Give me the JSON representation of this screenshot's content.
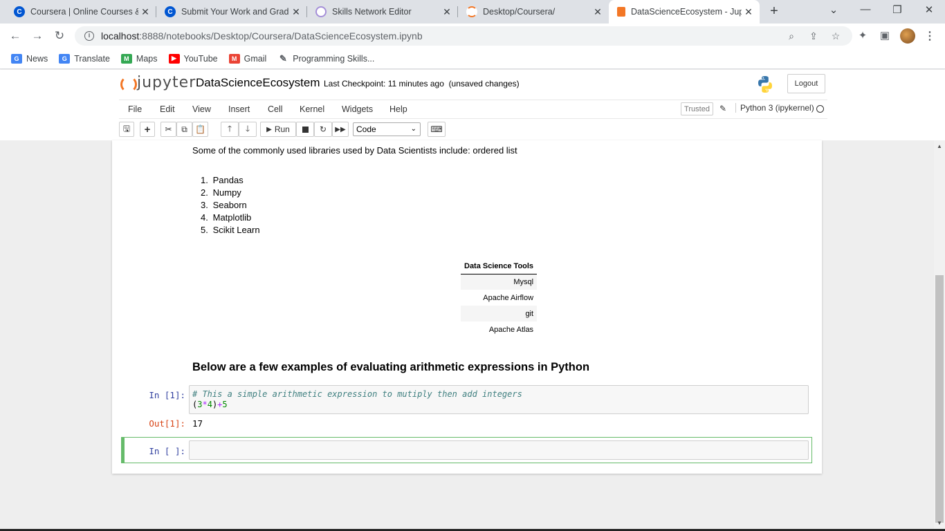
{
  "browser": {
    "tabs": [
      {
        "title": "Coursera | Online Courses &",
        "favicon": "C",
        "color": "#0056d2"
      },
      {
        "title": "Submit Your Work and Grade",
        "favicon": "C",
        "color": "#0056d2"
      },
      {
        "title": "Skills Network Editor",
        "favicon": "",
        "color": "#a58fd8"
      },
      {
        "title": "Desktop/Coursera/",
        "favicon": "",
        "color": "#f37726"
      },
      {
        "title": "DataScienceEcosystem - Jupy",
        "favicon": "",
        "color": "#f37726"
      }
    ],
    "url_host": "localhost",
    "url_rest": ":8888/notebooks/Desktop/Coursera/DataScienceEcosystem.ipynb",
    "bookmarks": [
      {
        "label": "News",
        "color": "#4285f4",
        "glyph": "G"
      },
      {
        "label": "Translate",
        "color": "#4285f4",
        "glyph": "G"
      },
      {
        "label": "Maps",
        "color": "#34a853",
        "glyph": "M"
      },
      {
        "label": "YouTube",
        "color": "#ff0000",
        "glyph": "▶"
      },
      {
        "label": "Gmail",
        "color": "#ea4335",
        "glyph": "M"
      },
      {
        "label": "Programming Skills...",
        "color": "#5f6368",
        "glyph": "✎"
      }
    ]
  },
  "jupyter": {
    "logo_text": "jupyter",
    "notebook_name": "DataScienceEcosystem",
    "checkpoint": "Last Checkpoint: 11 minutes ago",
    "unsaved": "(unsaved changes)",
    "logout_label": "Logout",
    "menu": [
      "File",
      "Edit",
      "View",
      "Insert",
      "Cell",
      "Kernel",
      "Widgets",
      "Help"
    ],
    "trusted_label": "Trusted",
    "kernel_name": "Python 3 (ipykernel)",
    "run_label": "Run",
    "cell_type": "Code"
  },
  "notebook": {
    "intro": "Some of the commonly used libraries used by Data Scientists include: ordered list",
    "libraries": [
      {
        "num": "1.",
        "name": "Pandas"
      },
      {
        "num": "2.",
        "name": "Numpy"
      },
      {
        "num": "3.",
        "name": "Seaborn"
      },
      {
        "num": "4.",
        "name": "Matplotlib"
      },
      {
        "num": "5.",
        "name": "Scikit Learn"
      }
    ],
    "table_header": "Data Science Tools",
    "tools": [
      "Mysql",
      "Apache Airflow",
      "git",
      "Apache Atlas"
    ],
    "heading": "Below are a few examples of evaluating arithmetic expressions in Python",
    "cell1_prompt": "In [1]:",
    "cell1_comment": "# This a simple arithmetic expression to mutiply then add integers",
    "cell1_out_prompt": "Out[1]:",
    "cell1_output": "17",
    "cell2_prompt": "In [ ]:"
  }
}
